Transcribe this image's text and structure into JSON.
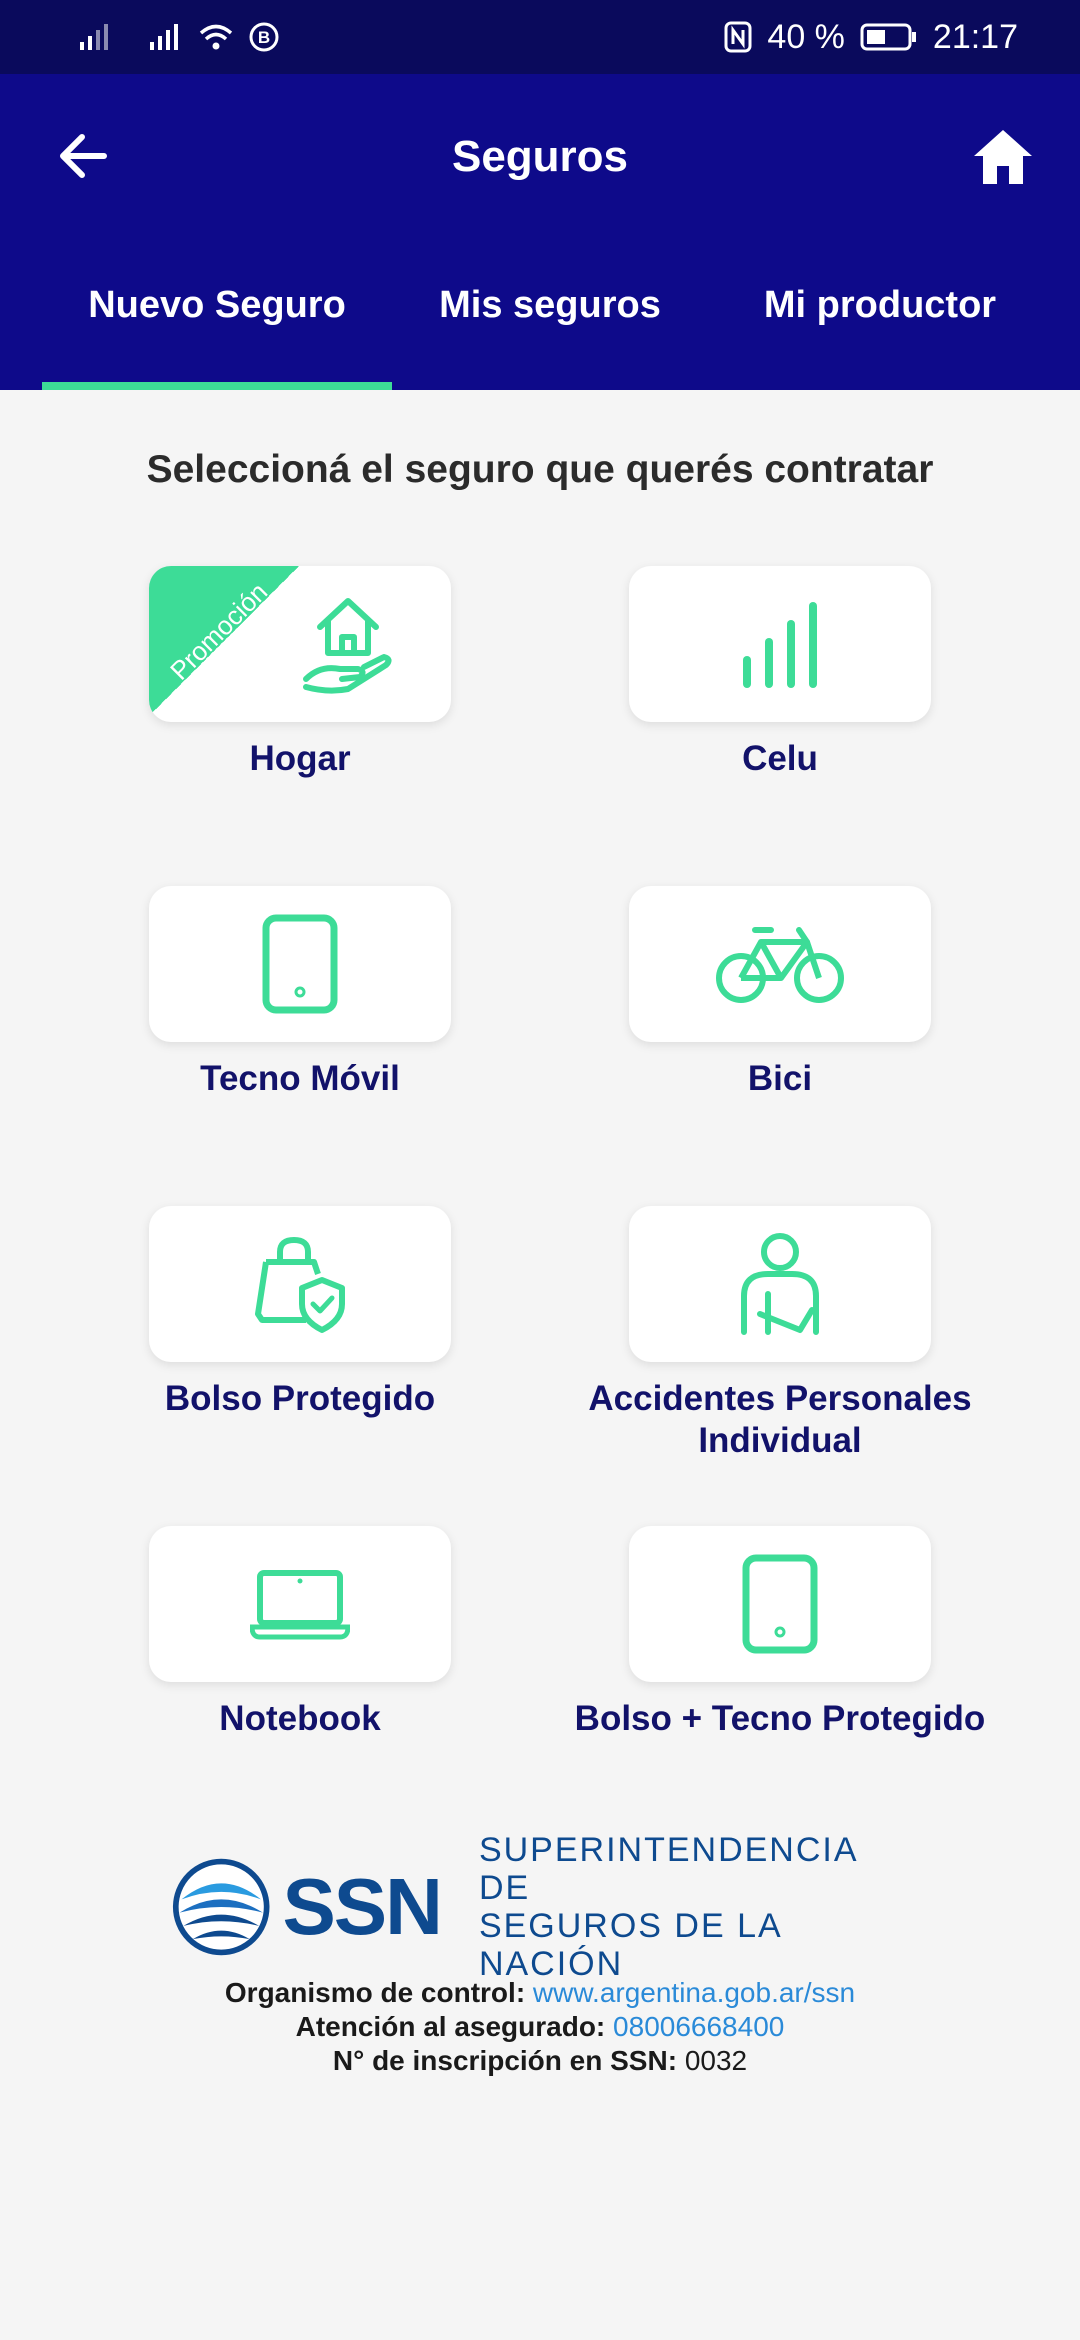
{
  "status_bar": {
    "battery": "40 %",
    "time": "21:17"
  },
  "header": {
    "title": "Seguros"
  },
  "tabs": [
    {
      "label": "Nuevo Seguro",
      "active": true
    },
    {
      "label": "Mis seguros",
      "active": false
    },
    {
      "label": "Mi productor",
      "active": false
    }
  ],
  "main": {
    "subtitle": "Seleccioná el seguro que querés contratar",
    "promo_label": "Promoción",
    "items": [
      {
        "label": "Hogar",
        "icon": "house-hand-icon"
      },
      {
        "label": "Celu",
        "icon": "signal-bars-icon"
      },
      {
        "label": "Tecno Móvil",
        "icon": "tablet-icon"
      },
      {
        "label": "Bici",
        "icon": "bicycle-icon"
      },
      {
        "label": "Bolso Protegido",
        "icon": "bag-shield-icon"
      },
      {
        "label": "Accidentes Personales Individual",
        "icon": "injured-person-icon"
      },
      {
        "label": "Notebook",
        "icon": "laptop-icon"
      },
      {
        "label": "Bolso + Tecno Protegido",
        "icon": "tablet-icon"
      }
    ]
  },
  "footer": {
    "logo_text": "SSN",
    "logo_full_line1": "SUPERINTENDENCIA DE",
    "logo_full_line2": "SEGUROS DE LA NACIÓN",
    "control_label": "Organismo de control:",
    "control_link": "www.argentina.gob.ar/ssn",
    "attention_label": "Atención al asegurado:",
    "attention_phone": "08006668400",
    "registration_label": "N° de inscripción en SSN:",
    "registration_value": "0032"
  },
  "colors": {
    "status_bar": "#0a0a5c",
    "app_bar": "#0e0a8a",
    "accent": "#3ddc97",
    "label": "#12126a",
    "link": "#2a8ad8"
  }
}
